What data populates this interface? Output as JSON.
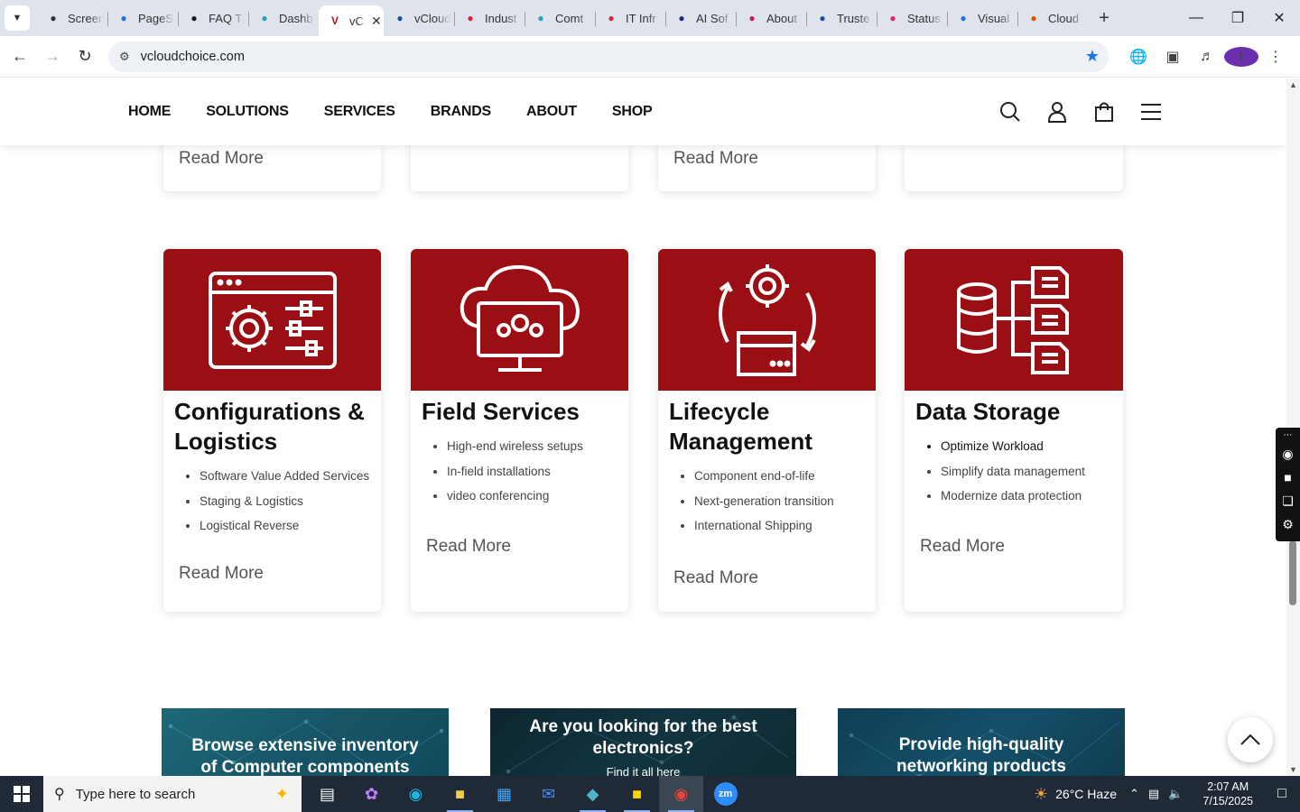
{
  "browser": {
    "tabs": [
      {
        "title": "Screen",
        "icon": "screen-icon",
        "color": "#333333"
      },
      {
        "title": "PageSpeed",
        "icon": "pagespeed-icon",
        "color": "#1a73e8"
      },
      {
        "title": "FAQ T",
        "icon": "faq-icon",
        "color": "#111111"
      },
      {
        "title": "Dashb",
        "icon": "dashboard-icon",
        "color": "#2aa3b4"
      },
      {
        "title": "vCl",
        "icon": "vcloud-icon",
        "color": "#b3121a",
        "active": true
      },
      {
        "title": "vCloud",
        "icon": "vcloud-check-icon",
        "color": "#1a4f9c"
      },
      {
        "title": "Indust",
        "icon": "industry-icon",
        "color": "#d7263d"
      },
      {
        "title": "Comt",
        "icon": "comt-icon",
        "color": "#2aa3b4"
      },
      {
        "title": "IT Infr",
        "icon": "it-infra-icon",
        "color": "#d7263d"
      },
      {
        "title": "AI Sof",
        "icon": "ai-software-icon",
        "color": "#1b2c7a"
      },
      {
        "title": "About",
        "icon": "about-icon",
        "color": "#c2185b"
      },
      {
        "title": "Truste",
        "icon": "trusted-icon",
        "color": "#1a4f9c"
      },
      {
        "title": "Status",
        "icon": "status-icon",
        "color": "#e91e63"
      },
      {
        "title": "Visual",
        "icon": "visual-icon",
        "color": "#1a73e8"
      },
      {
        "title": "Cloud",
        "icon": "cloud-icon",
        "color": "#e65100"
      }
    ],
    "url": "vcloudchoice.com",
    "profile_initial": "t"
  },
  "site": {
    "menu": [
      "HOME",
      "SOLUTIONS",
      "SERVICES",
      "BRANDS",
      "ABOUT",
      "SHOP"
    ],
    "read_more": "Read More",
    "accent": "#9b0e13",
    "cards": [
      {
        "title": "Configurations & Logistics",
        "items": [
          "Software Value Added Services",
          "Staging & Logistics",
          "Logistical Reverse"
        ]
      },
      {
        "title": "Field Services",
        "items": [
          "High-end wireless setups",
          "In-field installations",
          "video conferencing"
        ]
      },
      {
        "title": "Lifecycle Management",
        "items": [
          "Component end-of-life",
          "Next-generation transition",
          "International Shipping"
        ]
      },
      {
        "title": "Data Storage",
        "items": [
          "Optimize Workload",
          "Simplify data management",
          "Modernize data protection"
        ]
      }
    ],
    "banners": [
      {
        "line1": "Browse extensive inventory",
        "line2": "of Computer components"
      },
      {
        "line1": "Are you looking for the best",
        "line2": "electronics?",
        "line3": "Find it all here"
      },
      {
        "line1": "Provide high-quality",
        "line2": "networking products"
      }
    ]
  },
  "taskbar": {
    "search_placeholder": "Type here to search",
    "weather": "26°C  Haze",
    "time": "2:07 AM",
    "date": "7/15/2025"
  }
}
